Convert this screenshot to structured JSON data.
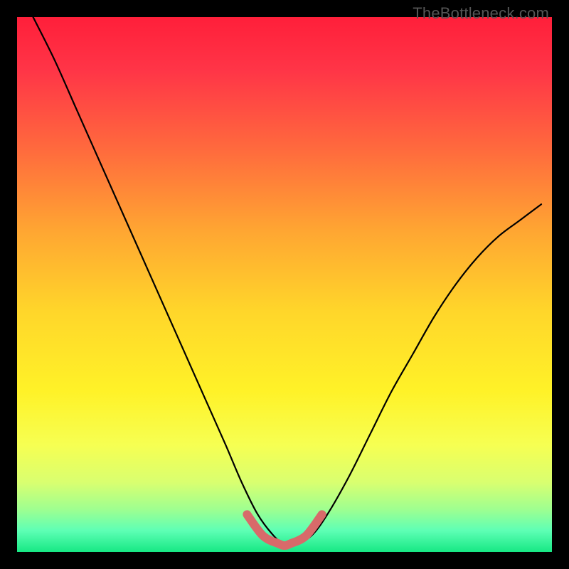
{
  "watermark": "TheBottleneck.com",
  "chart_data": {
    "type": "line",
    "title": "",
    "xlabel": "",
    "ylabel": "",
    "xlim": [
      0,
      1
    ],
    "ylim": [
      0,
      1
    ],
    "series": [
      {
        "name": "black-curve",
        "x": [
          0.03,
          0.07,
          0.11,
          0.15,
          0.19,
          0.23,
          0.27,
          0.31,
          0.35,
          0.39,
          0.42,
          0.45,
          0.48,
          0.5,
          0.52,
          0.55,
          0.58,
          0.62,
          0.66,
          0.7,
          0.74,
          0.78,
          0.82,
          0.86,
          0.9,
          0.94,
          0.98
        ],
        "values": [
          1.0,
          0.92,
          0.83,
          0.74,
          0.65,
          0.56,
          0.47,
          0.38,
          0.29,
          0.2,
          0.13,
          0.07,
          0.03,
          0.015,
          0.015,
          0.03,
          0.07,
          0.14,
          0.22,
          0.3,
          0.37,
          0.44,
          0.5,
          0.55,
          0.59,
          0.62,
          0.65
        ]
      },
      {
        "name": "highlight-band",
        "x": [
          0.43,
          0.46,
          0.49,
          0.5,
          0.51,
          0.54,
          0.57
        ],
        "values": [
          0.07,
          0.03,
          0.015,
          0.012,
          0.015,
          0.03,
          0.07
        ]
      }
    ],
    "gradient_stops": [
      {
        "offset": 0.0,
        "color": "#ff1f3a"
      },
      {
        "offset": 0.1,
        "color": "#ff3547"
      },
      {
        "offset": 0.25,
        "color": "#ff6b3d"
      },
      {
        "offset": 0.4,
        "color": "#ffa632"
      },
      {
        "offset": 0.55,
        "color": "#ffd62a"
      },
      {
        "offset": 0.7,
        "color": "#fff228"
      },
      {
        "offset": 0.8,
        "color": "#f6ff52"
      },
      {
        "offset": 0.87,
        "color": "#d9ff70"
      },
      {
        "offset": 0.92,
        "color": "#9fff90"
      },
      {
        "offset": 0.96,
        "color": "#5effb5"
      },
      {
        "offset": 1.0,
        "color": "#17e884"
      }
    ],
    "colors": {
      "curve": "#000000",
      "highlight": "#d86a6a"
    }
  }
}
